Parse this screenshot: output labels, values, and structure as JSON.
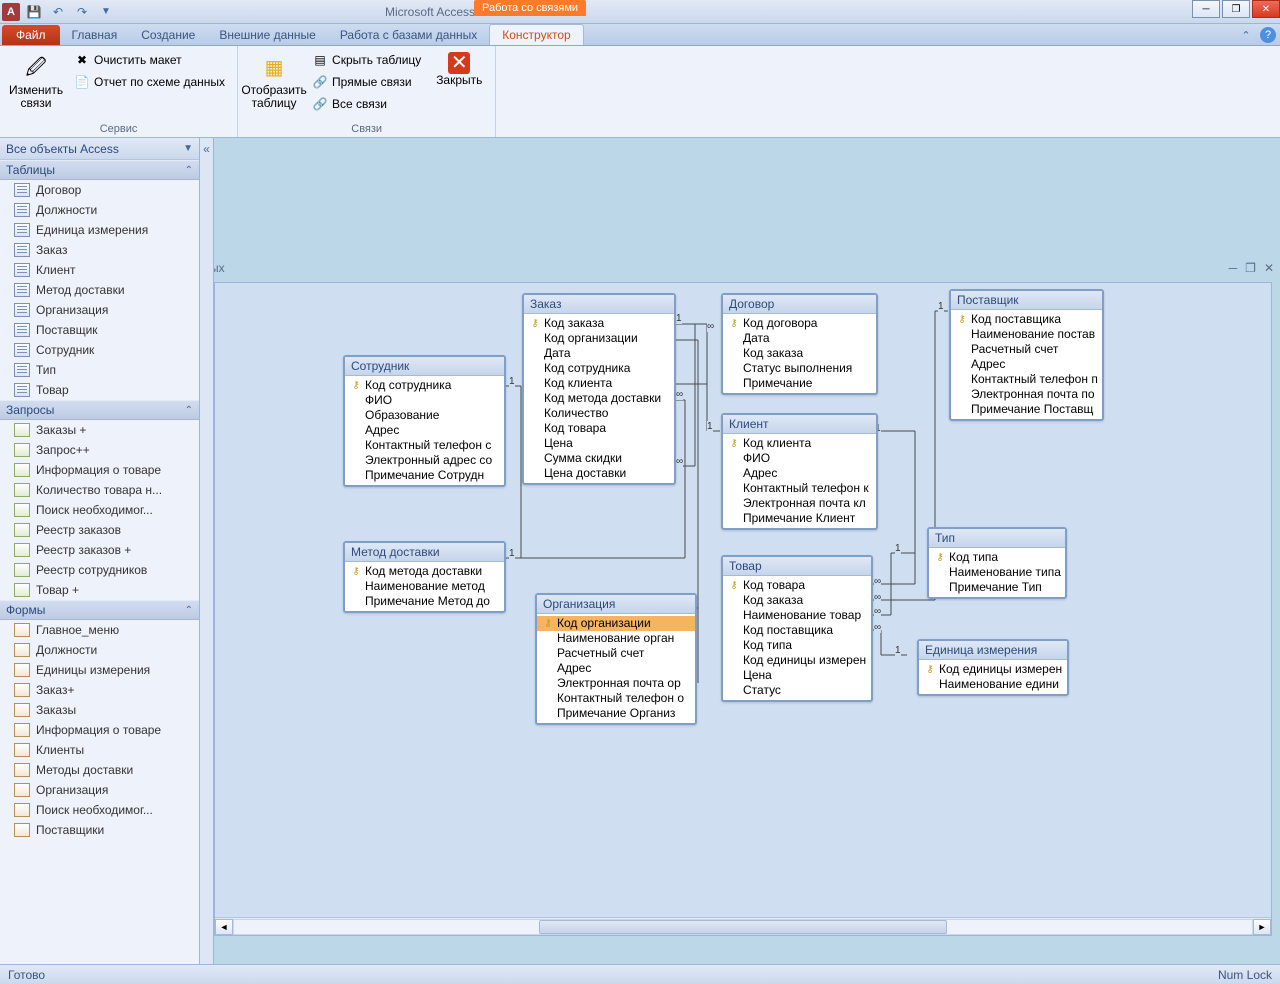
{
  "app": {
    "title": "Microsoft Access",
    "context_tab": "Работа со связями"
  },
  "tabs": {
    "file": "Файл",
    "items": [
      "Главная",
      "Создание",
      "Внешние данные",
      "Работа с базами данных",
      "Конструктор"
    ],
    "active_index": 4
  },
  "ribbon": {
    "group_service": "Сервис",
    "group_links": "Связи",
    "edit_links": "Изменить связи",
    "clear_layout": "Очистить макет",
    "schema_report": "Отчет по схеме данных",
    "show_table": "Отобразить таблицу",
    "hide_table": "Скрыть таблицу",
    "direct_links": "Прямые связи",
    "all_links": "Все связи",
    "close": "Закрыть"
  },
  "nav": {
    "header": "Все объекты Access",
    "groups": [
      {
        "title": "Таблицы",
        "type": "tbl",
        "items": [
          "Договор",
          "Должности",
          "Единица измерения",
          "Заказ",
          "Клиент",
          "Метод доставки",
          "Организация",
          "Поставщик",
          "Сотрудник",
          "Тип",
          "Товар"
        ]
      },
      {
        "title": "Запросы",
        "type": "qry",
        "items": [
          "Заказы +",
          "Запрос++",
          "Информация о товаре",
          "Количество товара н...",
          "Поиск необходимог...",
          "Реестр заказов",
          "Реестр заказов +",
          "Реестр сотрудников",
          "Товар +"
        ]
      },
      {
        "title": "Формы",
        "type": "frm",
        "items": [
          "Главное_меню",
          "Должности",
          "Единицы измерения",
          "Заказ+",
          "Заказы",
          "Информация о товаре",
          "Клиенты",
          "Методы доставки",
          "Организация",
          "Поиск необходимог...",
          "Поставщики"
        ]
      }
    ]
  },
  "doc_tab_suffix": "ых",
  "tables": {
    "sotrudnik": {
      "title": "Сотрудник",
      "key_field": "Код сотрудника",
      "fields": [
        "ФИО",
        "Образование",
        "Адрес",
        "Контактный телефон с",
        "Электронный адрес со",
        "Примечание Сотрудн"
      ]
    },
    "zakaz": {
      "title": "Заказ",
      "key_field": "Код заказа",
      "fields": [
        "Код организации",
        "Дата",
        "Код сотрудника",
        "Код клиента",
        "Код метода доставки",
        "Количество",
        "Код товара",
        "Цена",
        "Сумма скидки",
        "Цена доставки"
      ]
    },
    "dogovor": {
      "title": "Договор",
      "key_field": "Код договора",
      "fields": [
        "Дата",
        "Код заказа",
        "Статус выполнения",
        "Примечание"
      ]
    },
    "postavshik": {
      "title": "Поставщик",
      "key_field": "Код поставщика",
      "fields": [
        "Наименование постав",
        "Расчетный счет",
        "Адрес",
        "Контактный телефон п",
        "Электронная почта по",
        "Примечание Поставщ"
      ]
    },
    "klient": {
      "title": "Клиент",
      "key_field": "Код клиента",
      "fields": [
        "ФИО",
        "Адрес",
        "Контактный телефон к",
        "Электронная почта кл",
        "Примечание Клиент"
      ]
    },
    "tip": {
      "title": "Тип",
      "key_field": "Код типа",
      "fields": [
        "Наименование типа",
        "Примечание Тип"
      ]
    },
    "metod": {
      "title": "Метод доставки",
      "key_field": "Код метода доставки",
      "fields": [
        "Наименование метод",
        "Примечание Метод до"
      ]
    },
    "tovar": {
      "title": "Товар",
      "key_field": "Код товара",
      "fields": [
        "Код заказа",
        "Наименование товар",
        "Код поставщика",
        "Код типа",
        "Код единицы измерен",
        "Цена",
        "Статус"
      ]
    },
    "edizm": {
      "title": "Единица измерения",
      "key_field": "Код единицы измерен",
      "fields": [
        "Наименование едини"
      ]
    },
    "org": {
      "title": "Организация",
      "key_field": "Код организации",
      "fields": [
        "Наименование орган",
        "Расчетный счет",
        "Адрес",
        "Электронная почта ор",
        "Контактный телефон о",
        "Примечание Организ"
      ],
      "selected_key": true
    }
  },
  "status": {
    "left": "Готово",
    "right": "Num Lock"
  }
}
